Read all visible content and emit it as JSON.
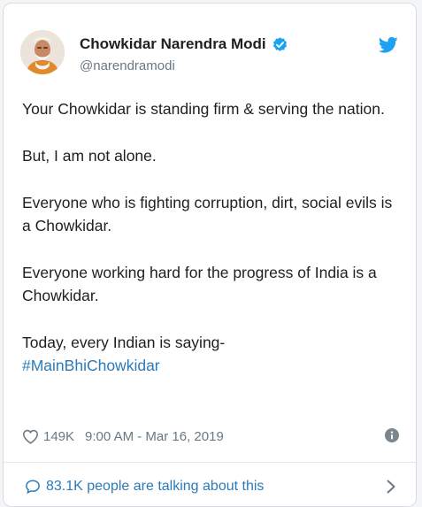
{
  "tweet": {
    "author_name": "Chowkidar Narendra Modi",
    "handle": "@narendramodi",
    "paragraphs": [
      "Your Chowkidar is standing firm & serving the nation.",
      "But, I am not alone.",
      "Everyone who is fighting corruption, dirt, social evils is a Chowkidar.",
      "Everyone working hard for the progress of India is a Chowkidar.",
      "Today, every Indian is saying-"
    ],
    "hashtag": "#MainBhiChowkidar",
    "likes": "149K",
    "timestamp": "9:00 AM - Mar 16, 2019"
  },
  "footer": {
    "talking_text": "83.1K people are talking about this"
  },
  "icons": {
    "avatar": "profile-photo",
    "verified": "verified-badge-icon",
    "brand": "twitter-bird-icon",
    "like": "heart-icon",
    "info": "info-icon",
    "conversation": "speech-bubble-icon",
    "navigate": "chevron-right-icon"
  },
  "colors": {
    "link": "#2b7bb9",
    "verified": "#1da1f2",
    "muted": "#697882",
    "text": "#1c2022"
  }
}
